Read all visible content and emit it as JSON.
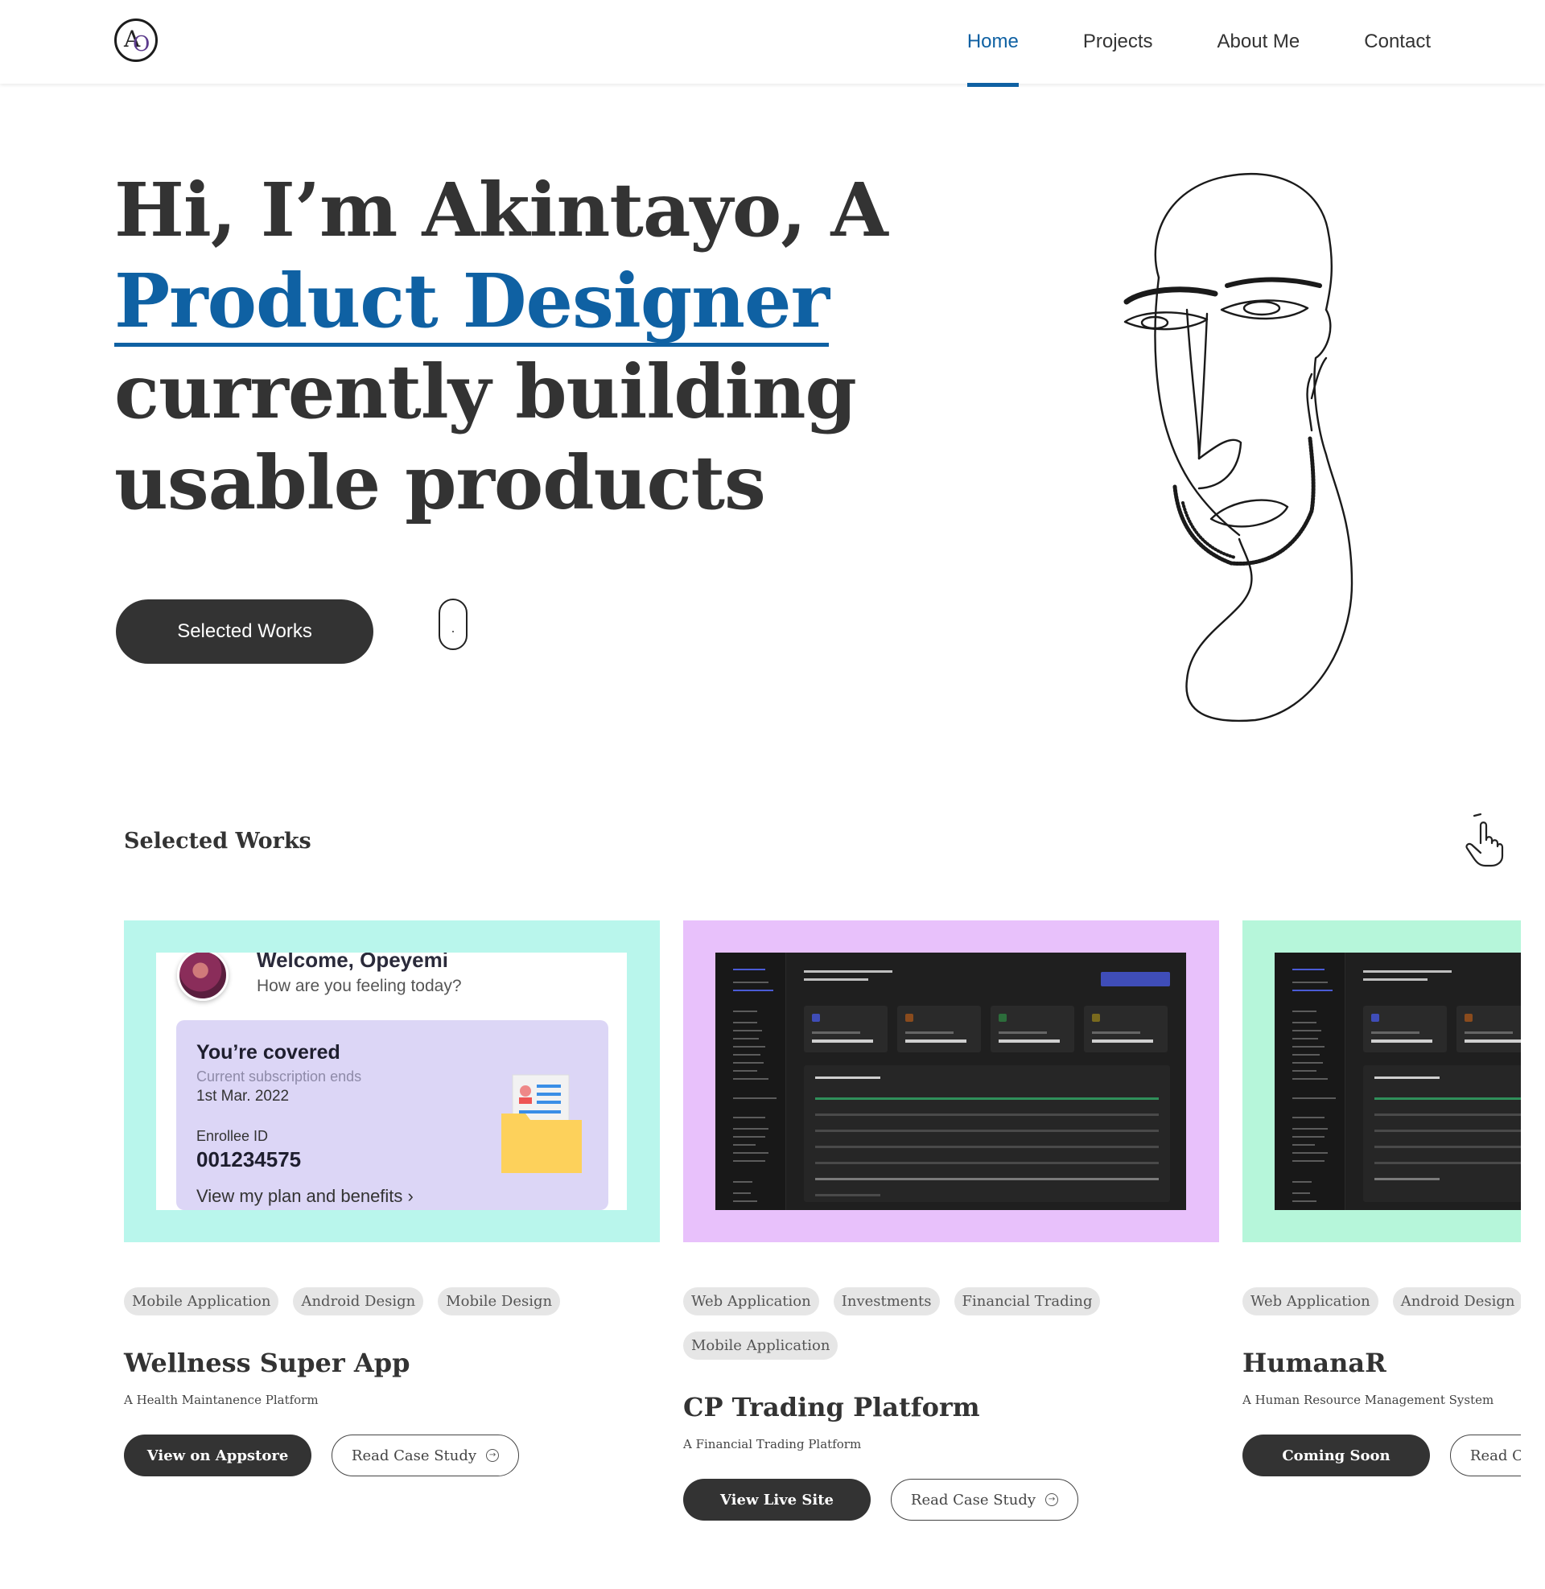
{
  "header": {
    "logo_letters": [
      "A",
      "O"
    ],
    "nav": [
      {
        "label": "Home",
        "active": true
      },
      {
        "label": "Projects",
        "active": false
      },
      {
        "label": "About Me",
        "active": false
      },
      {
        "label": "Contact",
        "active": false
      }
    ],
    "accent_color": "#0f61a3"
  },
  "hero": {
    "line1": "Hi, I’m Akintayo, A",
    "line2": "Product Designer",
    "line3": "currently building",
    "line4": "usable products",
    "cta_label": "Selected Works",
    "scroll_icon": "mouse-icon",
    "illustration_icon": "face-line-drawing"
  },
  "works": {
    "title": "Selected Works",
    "swipe_icon": "hand-pointer-icon",
    "cards": [
      {
        "tags": [
          "Mobile Application",
          "Android Design",
          "Mobile Design"
        ],
        "title": "Wellness Super App",
        "subtitle": "A Health Maintanence Platform",
        "primary": "View on Appstore",
        "secondary": "Read Case Study",
        "bg": "#b9f6ec",
        "screen": {
          "welcome": "Welcome, Opeyemi",
          "question": "How are you feeling today?",
          "covered": "You’re covered",
          "subscription": "Current subscription ends",
          "date": "1st Mar. 2022",
          "enrollee_label": "Enrollee ID",
          "enrollee_id": "001234575",
          "plan_link": "View my plan and benefits"
        }
      },
      {
        "tags": [
          "Web Application",
          "Investments",
          "Financial Trading",
          "Mobile Application"
        ],
        "title": "CP Trading Platform",
        "subtitle": "A Financial Trading Platform",
        "primary": "View Live Site",
        "secondary": "Read Case Study",
        "bg": "#e8c1fb"
      },
      {
        "tags": [
          "Web Application",
          "Android Design"
        ],
        "title": "HumanaR",
        "subtitle": "A Human Resource Management System",
        "primary": "Coming Soon",
        "secondary": "Read Case Study",
        "bg": "#b6f6da"
      }
    ]
  }
}
